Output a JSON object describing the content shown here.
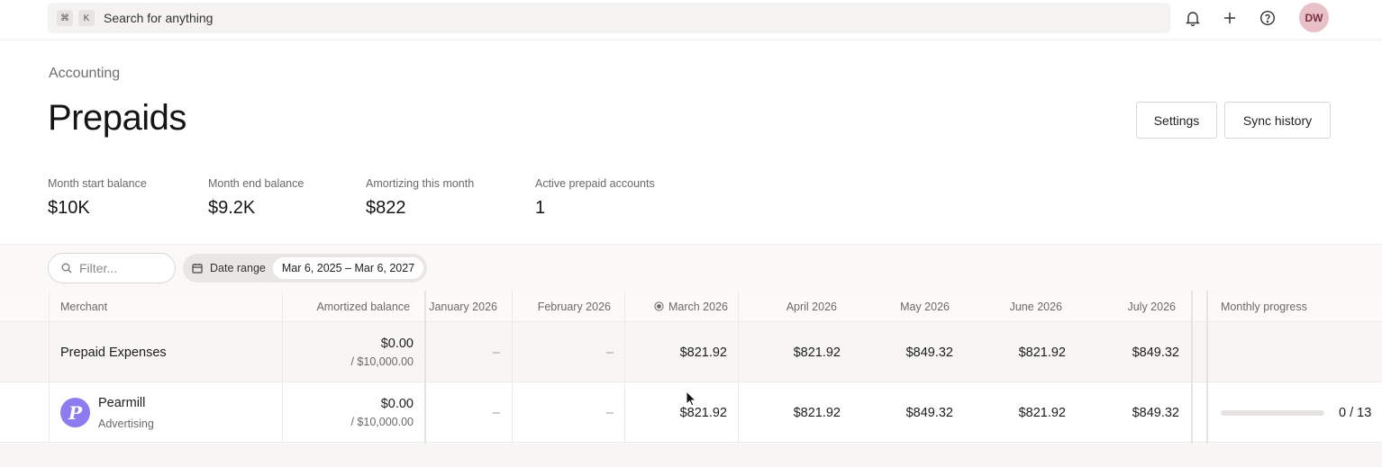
{
  "search": {
    "shortcut_cmd": "⌘",
    "shortcut_key": "K",
    "placeholder": "Search for anything"
  },
  "topbar": {
    "notifications_icon": "bell-icon",
    "add_icon": "plus-icon",
    "help_icon": "question-icon",
    "avatar_initials": "DW"
  },
  "header": {
    "breadcrumb": "Accounting",
    "title": "Prepaids",
    "settings_label": "Settings",
    "sync_history_label": "Sync history"
  },
  "stats": [
    {
      "label": "Month start balance",
      "value": "$10K"
    },
    {
      "label": "Month end balance",
      "value": "$9.2K"
    },
    {
      "label": "Amortizing this month",
      "value": "$822"
    },
    {
      "label": "Active prepaid accounts",
      "value": "1"
    }
  ],
  "filters": {
    "filter_placeholder": "Filter...",
    "date_range_label": "Date range",
    "date_range_value": "Mar 6, 2025 – Mar 6, 2027"
  },
  "table": {
    "columns": {
      "merchant": "Merchant",
      "amortized_balance": "Amortized balance",
      "jan": "January 2026",
      "feb": "February 2026",
      "mar": "March 2026",
      "apr": "April 2026",
      "may": "May 2026",
      "jun": "June 2026",
      "jul": "July 2026",
      "progress": "Monthly progress"
    },
    "group_row": {
      "name": "Prepaid Expenses",
      "balance": "$0.00",
      "balance_total": "/ $10,000.00",
      "jan": "–",
      "feb": "–",
      "mar": "$821.92",
      "apr": "$821.92",
      "may": "$849.32",
      "jun": "$821.92",
      "jul": "$849.32"
    },
    "item_row": {
      "logo_letter": "P",
      "name": "Pearmill",
      "category": "Advertising",
      "balance": "$0.00",
      "balance_total": "/ $10,000.00",
      "jan": "–",
      "feb": "–",
      "mar": "$821.92",
      "apr": "$821.92",
      "may": "$849.32",
      "jun": "$821.92",
      "jul": "$849.32",
      "progress_text": "0 / 13",
      "progress_fraction": 0
    }
  },
  "colors": {
    "accent": "#8b7cf0",
    "avatar_bg": "#e8c1c8"
  }
}
